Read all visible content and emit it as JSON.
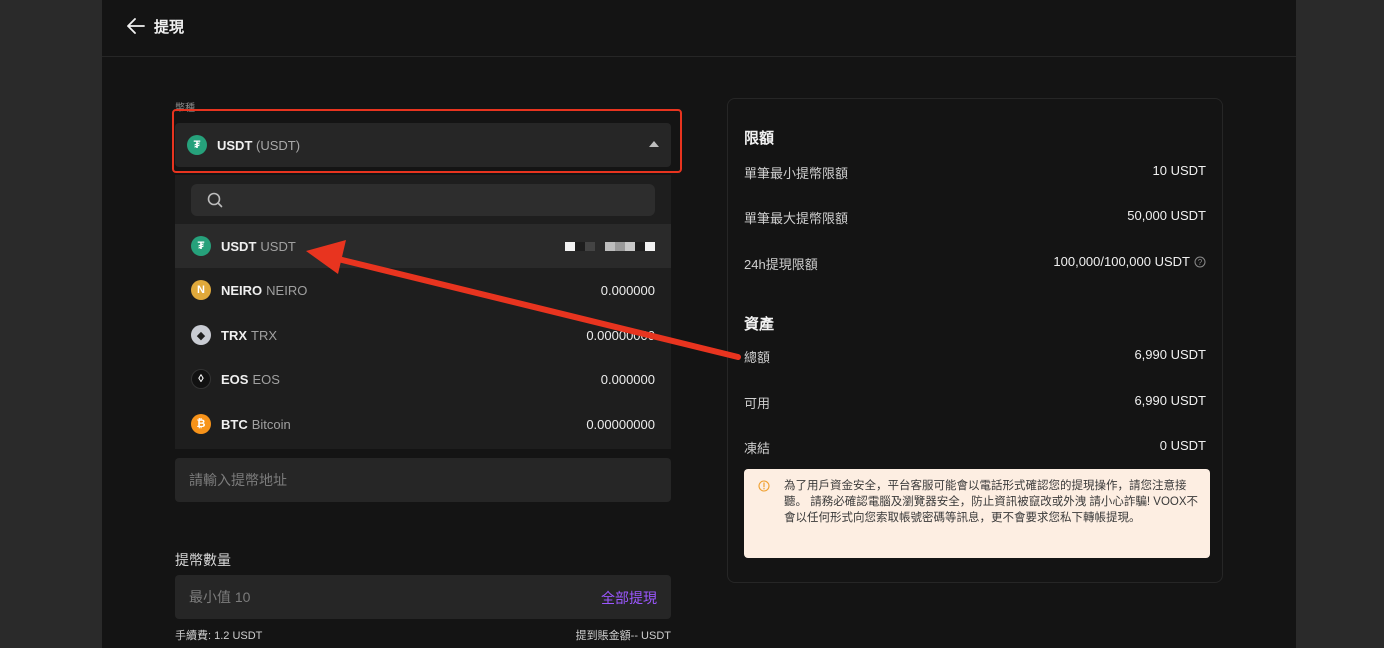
{
  "header": {
    "back_label": "提現"
  },
  "coin_field": {
    "label": "幣種",
    "selected_name": "USDT",
    "selected_sub": "(USDT)"
  },
  "dropdown": {
    "items": [
      {
        "name": "USDT",
        "full": "USDT",
        "balance": "",
        "color": "#26a17b",
        "symbol": "₮"
      },
      {
        "name": "NEIRO",
        "full": "NEIRO",
        "balance": "0.000000",
        "color": "#e0a93b",
        "symbol": "N"
      },
      {
        "name": "TRX",
        "full": "TRX",
        "balance": "0.00000000",
        "color": "#c9ccd3",
        "symbol": "◆"
      },
      {
        "name": "EOS",
        "full": "EOS",
        "balance": "0.000000",
        "color": "#111111",
        "symbol": "◊"
      },
      {
        "name": "BTC",
        "full": "Bitcoin",
        "balance": "0.00000000",
        "color": "#f7931a",
        "symbol": "₿"
      }
    ]
  },
  "address": {
    "placeholder": "請輸入提幣地址"
  },
  "amount": {
    "label": "提幣數量",
    "placeholder": "最小值 10",
    "withdraw_all": "全部提現",
    "fee": "手續費: 1.2 USDT",
    "receive": "提到賬金額-- USDT"
  },
  "limits": {
    "title": "限額",
    "rows": [
      {
        "label": "單筆最小提幣限額",
        "value": "10 USDT"
      },
      {
        "label": "單筆最大提幣限額",
        "value": "50,000 USDT"
      },
      {
        "label": "24h提現限額",
        "value": "100,000/100,000 USDT"
      }
    ]
  },
  "assets": {
    "title": "資產",
    "rows": [
      {
        "label": "總額",
        "value": "6,990 USDT"
      },
      {
        "label": "可用",
        "value": "6,990 USDT"
      },
      {
        "label": "凍結",
        "value": "0 USDT"
      }
    ]
  },
  "notice": {
    "text": "為了用戶資金安全，平台客服可能會以電話形式確認您的提現操作，請您注意接聽。 請務必確認電腦及瀏覽器安全，防止資訊被竄改或外洩 請小心詐騙! VOOX不會以任何形式向您索取帳號密碼等訊息，更不會要求您私下轉帳提現。"
  },
  "colors": {
    "highlight": "#e8341f",
    "accent": "#9b57ff",
    "notice_bg": "#fdeee2"
  }
}
